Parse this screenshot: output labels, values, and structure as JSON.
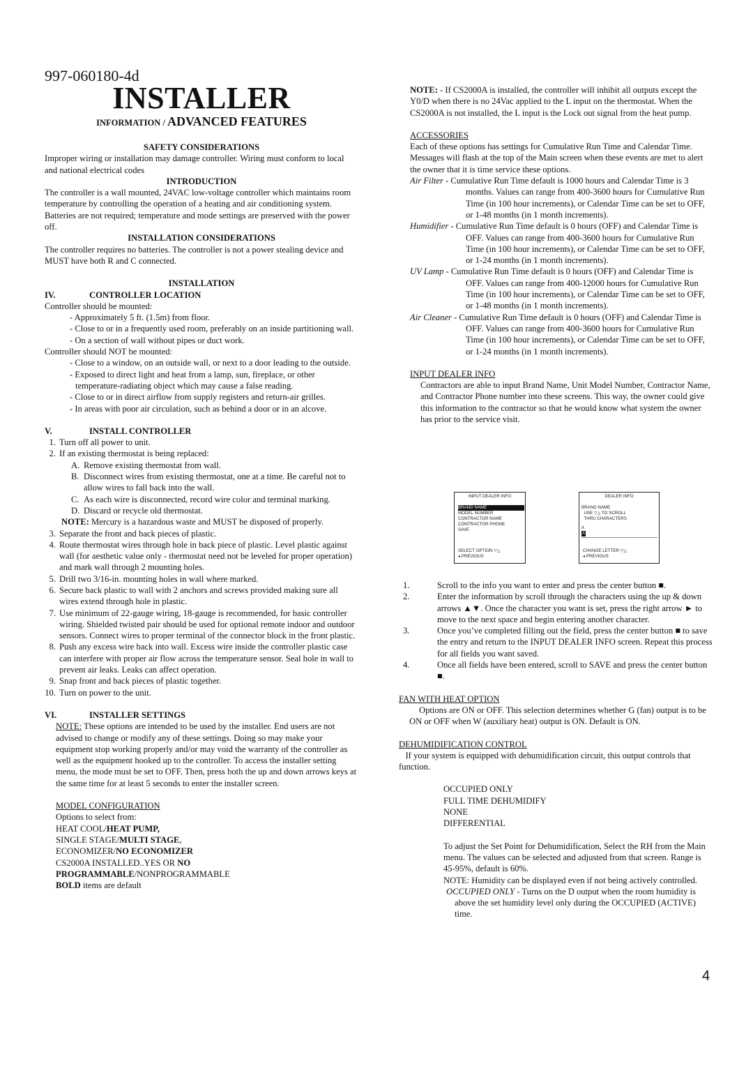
{
  "header": {
    "doc_number": "997-060180-4d",
    "title": "INSTALLER",
    "subtitle_small": "INFORMATION / ",
    "subtitle_large": "ADVANCED FEATURES"
  },
  "safety": {
    "heading": "SAFETY CONSIDERATIONS",
    "text": "Improper wiring or installation may damage controller.   Wiring must conform to local and national electrical codes"
  },
  "introduction": {
    "heading": "INTRODUCTION",
    "text": "The controller is a wall mounted, 24VAC low-voltage controller which maintains room temperature by controlling the operation of a heating and air conditioning system.  Batteries are not required; temperature and mode settings are preserved with the power off."
  },
  "install_considerations": {
    "heading": "INSTALLATION CONSIDERATIONS",
    "text": "The controller requires no batteries.  The controller is not a power stealing device and MUST have both R and C connected."
  },
  "installation": {
    "heading": "INSTALLATION",
    "section_iv": {
      "num": "IV.",
      "title": "CONTROLLER LOCATION"
    },
    "mounted_intro": "Controller should be mounted:",
    "mounted": [
      "- Approximately 5 ft. (1.5m) from floor.",
      "- Close to or in a frequently used room, preferably on an inside partitioning wall.",
      "- On a section of wall without pipes or duct work."
    ],
    "not_mounted_intro": "Controller should NOT be mounted:",
    "not_mounted": [
      "- Close to a window, on an outside wall, or next to a door leading to the outside.",
      "- Exposed to direct light and heat from a lamp, sun, fireplace, or other temperature-radiating object which may cause a false reading.",
      "- Close to or in direct airflow from supply registers and return-air grilles.",
      "- In areas with poor air circulation, such as behind a door or in an alcove."
    ]
  },
  "install_controller": {
    "num": "V.",
    "title": "INSTALL CONTROLLER",
    "steps_a": [
      {
        "n": "1.",
        "t": "Turn off all power to unit."
      },
      {
        "n": "2.",
        "t": "If an existing thermostat is being replaced:"
      }
    ],
    "substeps": [
      {
        "n": "A.",
        "t": "Remove existing thermostat from wall."
      },
      {
        "n": "B.",
        "t": "Disconnect wires from existing thermostat, one at a time.  Be careful not to allow wires to fall back into the wall."
      },
      {
        "n": "C.",
        "t": "As each wire is disconnected, record wire color and terminal marking."
      },
      {
        "n": "D.",
        "t": "Discard or recycle old thermostat."
      }
    ],
    "note_label": "NOTE:",
    "note_text": "  Mercury is a hazardous waste and MUST be disposed of properly.",
    "steps_b": [
      {
        "n": "3.",
        "t": "Separate the front and back pieces of plastic."
      },
      {
        "n": "4.",
        "t": "Route thermostat wires through hole in back piece of plastic.  Level plastic against wall (for aesthetic value only - thermostat need not be leveled for proper operation) and mark wall through 2 mounting holes."
      },
      {
        "n": "5.",
        "t": "Drill two 3/16-in. mounting holes in wall where marked."
      },
      {
        "n": "6.",
        "t": "Secure back plastic to wall with 2 anchors and screws provided making sure all wires extend through hole in plastic."
      },
      {
        "n": "7.",
        "t": "Use minimum of 22-gauge wiring, 18-gauge is recommended, for basic controller wiring. Shielded twisted pair should be used for optional remote indoor and outdoor sensors.  Connect wires to proper terminal of the connector block in the front plastic."
      },
      {
        "n": "8.",
        "t": "Push any excess wire back into wall.  Excess wire inside the controller plastic case can interfere with proper air flow across the temperature sensor.  Seal hole in wall to prevent air leaks.  Leaks can affect operation."
      },
      {
        "n": "9.",
        "t": "Snap front and back pieces of plastic together."
      },
      {
        "n": "10.",
        "t": "Turn on power to the unit."
      }
    ]
  },
  "installer_settings": {
    "num": "VI.",
    "title": "INSTALLER SETTINGS",
    "note_label": "NOTE:",
    "note_text": "    These options are intended to be used by the installer.  End users are not advised to change or modify any of these settings.  Doing so may make your equipment stop working properly and/or may void the warranty of the controller as well as the equipment hooked up to the controller.  To access the installer setting menu, the mode must be set to OFF.  Then, press both the up and down arrows keys at the same time for at least 5 seconds to enter the installer screen."
  },
  "model_config": {
    "heading": "MODEL CONFIGURATION",
    "intro": " Options to select from:",
    "options": [
      {
        "normal": "HEAT COOL/",
        "bold": "HEAT PUMP,",
        "tail": ""
      },
      {
        "normal": "SINGLE STAGE/",
        "bold": "MULTI STAGE",
        "tail": ","
      },
      {
        "normal": "ECONOMIZER/",
        "bold": "NO ECONOMIZER",
        "tail": ""
      },
      {
        "normal": "CS2000A INSTALLED..YES OR ",
        "bold": "NO",
        "tail": ""
      }
    ],
    "prog_bold": "PROGRAMMABLE",
    "prog_normal": "/NONPROGRAMMABLE",
    "legend_bold": "BOLD",
    "legend_normal": " items are default"
  },
  "cs2000a_note": {
    "label": "NOTE:",
    "text": " - If CS2000A is installed, the controller will inhibit all outputs except the Y0/D when there is no 24Vac applied to the L input on the thermostat.  When the CS2000A is not installed, the L input is the Lock out signal from the heat pump."
  },
  "accessories": {
    "heading": "ACCESSORIES",
    "intro": "Each of these options has settings for Cumulative Run Time and Calendar Time.  Messages will flash at the top of the Main screen when these events are met to alert the owner that it is time service these options.",
    "items": [
      {
        "label": "Air Filter",
        "text": " - Cumulative Run Time default is 1000 hours and Calendar Time is 3 months.  Values can range from 400-3600 hours for Cumulative Run Time (in 100 hour increments), or Calendar Time can be set to OFF, or 1-48 months (in 1 month increments)."
      },
      {
        "label": "Humidifier",
        "text": " - Cumulative Run Time default is 0 hours (OFF) and Calendar Time is OFF.  Values can range from 400-3600 hours for Cumulative Run Time (in 100 hour increments), or Calendar Time can be set to OFF, or 1-24 months (in 1 month increments)."
      },
      {
        "label": "UV Lamp",
        "text": " - Cumulative Run Time default is 0 hours (OFF) and Calendar Time is OFF.  Values can range from 400-12000 hours for Cumulative Run Time (in 100 hour increments), or Calendar Time can be set to OFF, or 1-48 months (in 1 month increments)."
      },
      {
        "label": "Air Cleaner",
        "text": " - Cumulative Run Time default is 0 hours (OFF) and Calendar Time is OFF.  Values can range from 400-3600 hours for Cumulative Run Time (in 100 hour increments), or Calendar Time can be set to OFF, or 1-24 months (in 1 month increments)."
      }
    ]
  },
  "dealer_info": {
    "heading": "INPUT DEALER INFO",
    "text": "Contractors are able to input Brand Name, Unit Model Number, Contractor Name, and Contractor Phone number into these screens.  This way, the owner could give this information to the contractor so that he would know what system the owner has prior to the service visit.",
    "screen1": {
      "title": "INPUT DEALER INFO",
      "items": [
        "BRAND NAME",
        "MODEL NUMBER",
        "CONTRACTOR NAME",
        "CONTRACTOR PHONE",
        "SAVE"
      ],
      "selected_index": 0,
      "footer1": "SELECT OPTION ▽△",
      "footer2": "◂ PREVIOUS"
    },
    "screen2": {
      "title": "DEALER INFO",
      "field": "BRAND NAME",
      "hint1": "  USE ▽△ TO SCROLL",
      "hint2": "  THRU CHARACTERS",
      "value": "A",
      "cursor_char": "A",
      "footer1": "CHANGE LETTER ▽△",
      "footer2": "◂ PREVIOUS"
    },
    "steps": [
      {
        "n": "1.",
        "t": "Scroll to the info you want to enter and press the center button  ■."
      },
      {
        "n": "2.",
        "t": "Enter the information by scroll through the characters using the up & down arrows ▲▼.  Once the character you want is set, press the right arrow ► to move to the next space and begin entering another character."
      },
      {
        "n": "3.",
        "t": "Once you’ve completed filling out the field, press the center button ■ to save the entry and return to the INPUT DEALER INFO screen.  Repeat this process for all fields you want saved."
      },
      {
        "n": "4.",
        "t": "Once all fields have been entered, scroll to SAVE and press the center button ■."
      }
    ]
  },
  "fan_heat": {
    "heading": "FAN WITH HEAT OPTION",
    "text": "Options are ON or OFF.  This selection determines whether G (fan) output is to be ON or OFF when W (auxiliary heat) output is ON.  Default is ON."
  },
  "dehumid": {
    "heading": "DEHUMIDIFICATION CONTROL",
    "text": "   If your system is equipped with dehumidification circuit, this output controls that function.",
    "options": [
      "OCCUPIED ONLY",
      "FULL TIME DEHUMIDIFY",
      "NONE",
      "DIFFERENTIAL"
    ],
    "setpoint": "To adjust the Set Point for Dehumidification, Select the RH from the Main menu.  The values can be selected and adjusted from that screen.  Range is 45-95%, default is 60%.",
    "note": "NOTE: Humidity can be displayed even if not being actively controlled.",
    "occ_label": "OCCUPIED ONLY",
    "occ_text": " - Turns on the D output when the room humidity is above the set humidity level only during the OCCUPIED (ACTIVE) time."
  },
  "page_number": "4"
}
